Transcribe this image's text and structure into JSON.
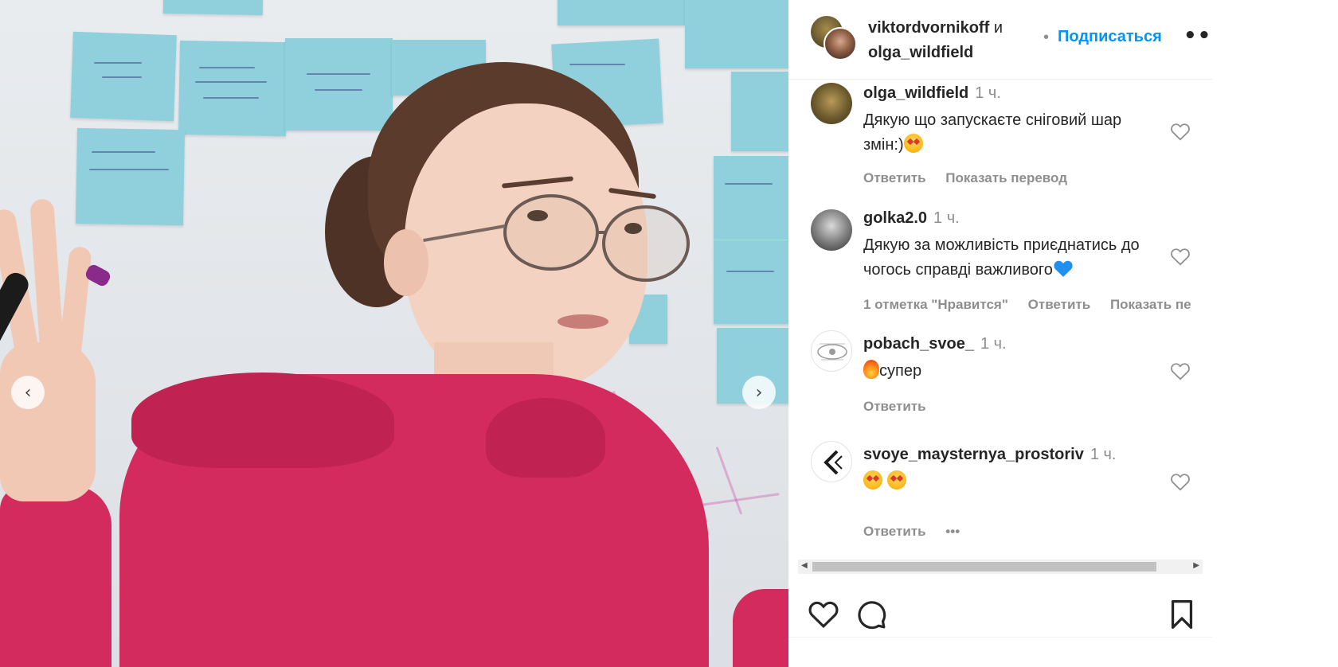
{
  "post": {
    "author_primary": "viktordvornikoff",
    "conjunction": "и",
    "author_secondary": "olga_wildfield",
    "separator": "•",
    "follow_label": "Подписаться",
    "more_label": "•••"
  },
  "carousel": {
    "prev_icon": "chevron-left-icon",
    "next_icon": "chevron-right-icon"
  },
  "comments": [
    {
      "username": "olga_wildfield",
      "time": "1 ч.",
      "text": "Дякую що запускаєте сніговий шар змін:)",
      "emoji": [
        "star-eyes"
      ],
      "actions": [
        "Ответить",
        "Показать перевод"
      ]
    },
    {
      "username": "golka2.0",
      "time": "1 ч.",
      "text": "Дякую за можливість приєднатись до чогось справді важливого",
      "emoji": [
        "blue-heart"
      ],
      "actions": [
        "1 отметка \"Нравится\"",
        "Ответить",
        "Показать пе"
      ]
    },
    {
      "username": "pobach_svoe_",
      "time": "1 ч.",
      "text": "супер",
      "emoji": [
        "fire"
      ],
      "actions": [
        "Ответить"
      ]
    },
    {
      "username": "svoye_maysternya_prostoriv",
      "time": "1 ч.",
      "text": "",
      "emoji": [
        "star-eyes",
        "star-eyes"
      ],
      "actions": [
        "Ответить",
        "•••"
      ]
    }
  ],
  "action_bar": {
    "icons": [
      "heart-icon",
      "comment-icon",
      "bookmark-icon"
    ]
  },
  "colors": {
    "accent": "#0095f6",
    "text": "#262626",
    "muted": "#8e8e8e",
    "hoodie": "#d42b5e",
    "sticky_note": "#8fd0dc"
  }
}
